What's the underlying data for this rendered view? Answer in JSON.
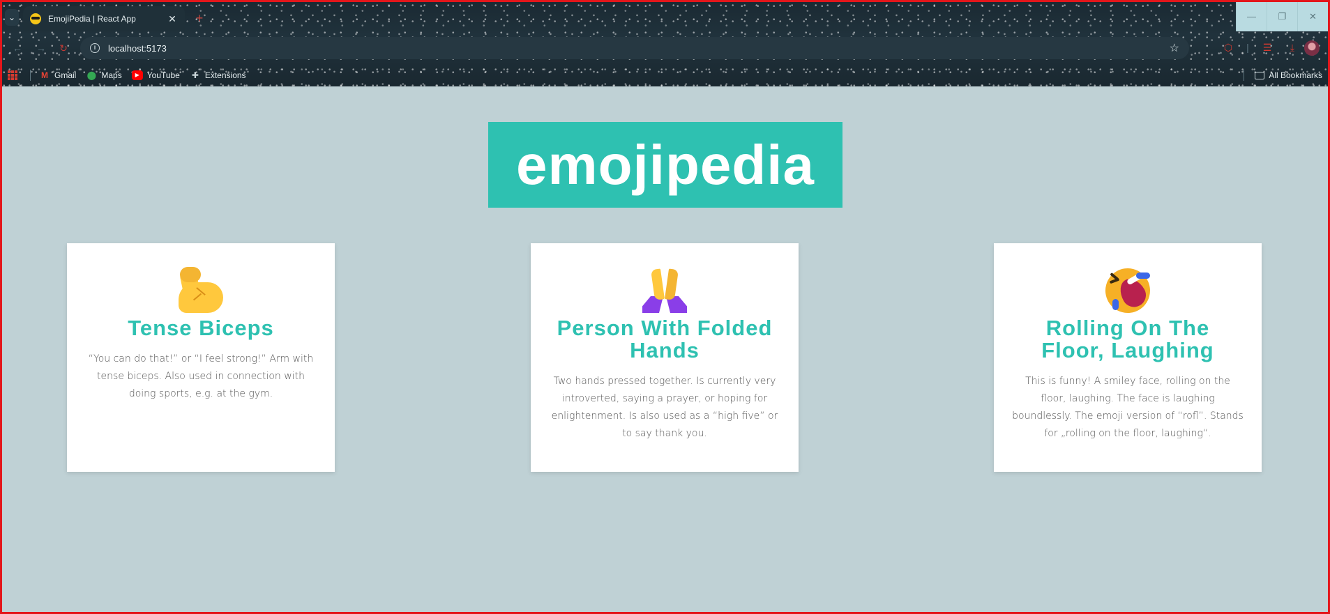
{
  "browser": {
    "tab_title": "EmojiPedia | React App",
    "tab_close": "✕",
    "new_tab": "+",
    "url": "localhost:5173",
    "window_controls": [
      "—",
      "❐",
      "✕"
    ],
    "bookmarks": [
      {
        "label": "Gmail",
        "icon": "gmail-icon"
      },
      {
        "label": "Maps",
        "icon": "maps-icon"
      },
      {
        "label": "YouTube",
        "icon": "youtube-icon"
      },
      {
        "label": "Extensions",
        "icon": "puzzle-icon"
      }
    ],
    "all_bookmarks": "All Bookmarks"
  },
  "page": {
    "title": "emojipedia",
    "accent_color": "#2ec1b1",
    "background_color": "#bfd1d5"
  },
  "cards": [
    {
      "name": "Tense Biceps",
      "emoji": "flexed-biceps-icon",
      "description": "“You can do that!” or “I feel strong!” Arm with tense biceps. Also used in connection with doing sports, e.g. at the gym."
    },
    {
      "name": "Person With Folded Hands",
      "emoji": "folded-hands-icon",
      "description": "Two hands pressed together. Is currently very introverted, saying a prayer, or hoping for enlightenment. Is also used as a “high five” or to say thank you."
    },
    {
      "name": "Rolling On The Floor, Laughing",
      "emoji": "rofl-icon",
      "description": "This is funny! A smiley face, rolling on the floor, laughing. The face is laughing boundlessly. The emoji version of “rofl”. Stands for „rolling on the floor, laughing“."
    }
  ]
}
